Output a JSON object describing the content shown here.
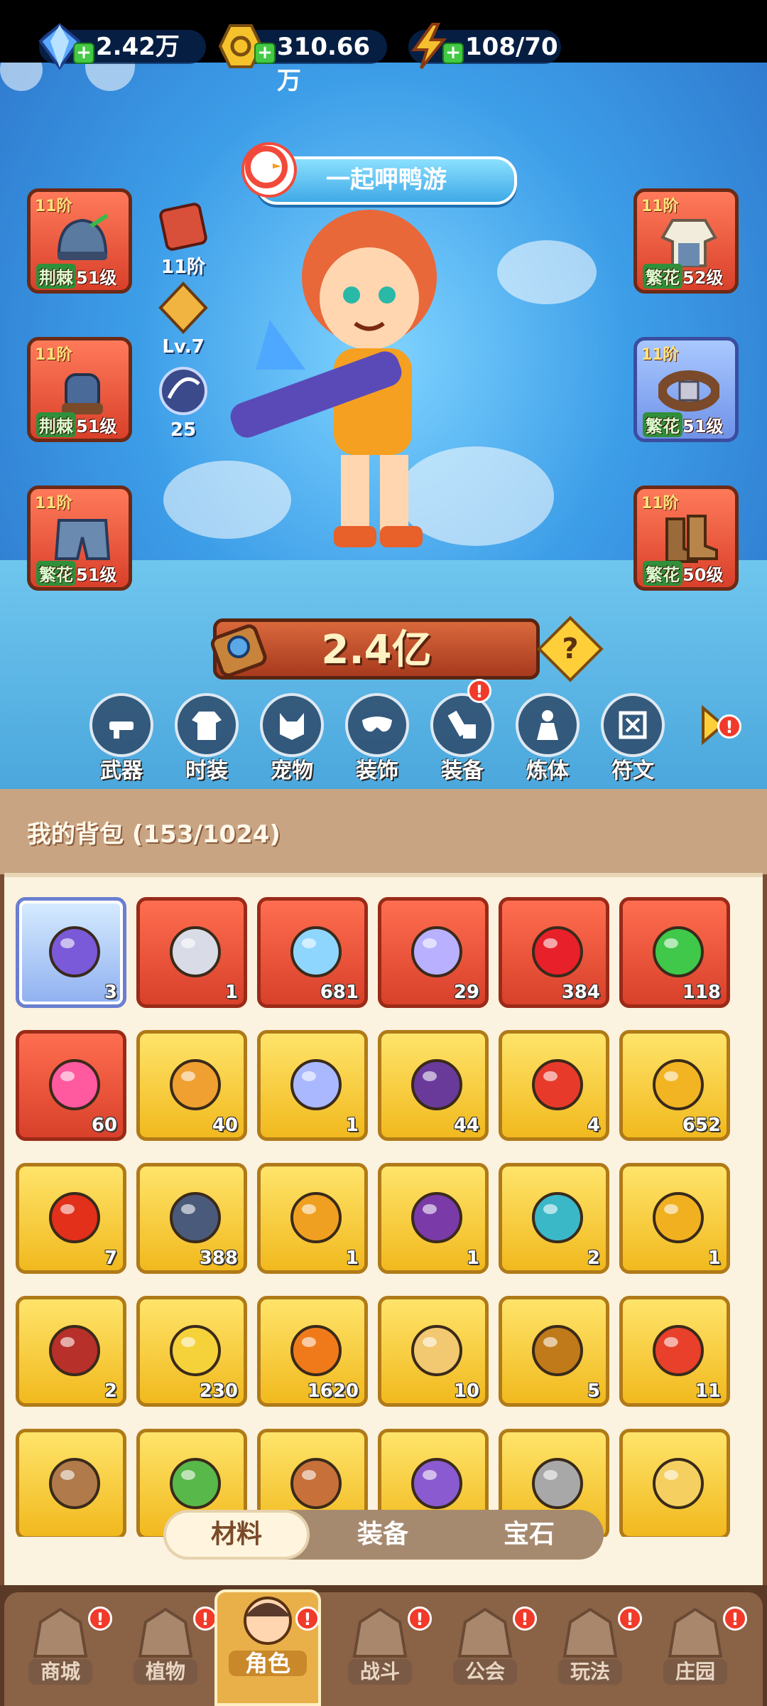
{
  "currencies": [
    {
      "name": "diamond",
      "value": "2.42万",
      "color": "#5aa8ff"
    },
    {
      "name": "gold",
      "value": "310.66万",
      "color": "#f6c22c"
    },
    {
      "name": "energy",
      "value": "108/70",
      "color": "#f5c030"
    }
  ],
  "event_banner": "一起呷鸭游",
  "equipment_left": [
    {
      "stage": "11阶",
      "tag": "荆棘",
      "level": "51级",
      "icon": "helmet-icon"
    },
    {
      "stage": "11阶",
      "tag": "荆棘",
      "level": "51级",
      "icon": "gloves-icon"
    },
    {
      "stage": "11阶",
      "tag": "繁花",
      "level": "51级",
      "icon": "shorts-icon"
    }
  ],
  "equipment_right": [
    {
      "stage": "11阶",
      "tag": "繁花",
      "level": "52级",
      "icon": "jacket-icon"
    },
    {
      "stage": "11阶",
      "tag": "繁花",
      "level": "51级",
      "icon": "belt-icon"
    },
    {
      "stage": "11阶",
      "tag": "繁花",
      "level": "50级",
      "icon": "boots-icon"
    }
  ],
  "mini_stats": [
    {
      "label": "11阶",
      "icon": "backpack-icon"
    },
    {
      "label": "Lv.7",
      "icon": "crystal-icon"
    },
    {
      "label": "25",
      "icon": "orb-icon"
    }
  ],
  "power": "2.4亿",
  "help_label": "?",
  "features": [
    {
      "label": "武器",
      "icon": "weapon-icon",
      "alert": false
    },
    {
      "label": "时装",
      "icon": "outfit-icon",
      "alert": false
    },
    {
      "label": "宠物",
      "icon": "pet-icon",
      "alert": false
    },
    {
      "label": "装饰",
      "icon": "mask-icon",
      "alert": false
    },
    {
      "label": "装备",
      "icon": "equipment-icon",
      "alert": true
    },
    {
      "label": "炼体",
      "icon": "body-icon",
      "alert": false
    },
    {
      "label": "符文",
      "icon": "rune-icon",
      "alert": false
    }
  ],
  "alert_mark": "!",
  "bag": {
    "title": "我的背包 (153/1024)",
    "items": [
      {
        "count": "3",
        "bg": "blue",
        "icon": "mask-icon",
        "color": "#7a5ad8"
      },
      {
        "count": "1",
        "bg": "red",
        "icon": "gear-cross-icon",
        "color": "#d9dce6"
      },
      {
        "count": "681",
        "bg": "red",
        "icon": "star-crystal-icon",
        "color": "#8fd6ff"
      },
      {
        "count": "29",
        "bg": "red",
        "icon": "moon-crystal-icon",
        "color": "#b9b0ff"
      },
      {
        "count": "384",
        "bg": "red",
        "icon": "red-potion-icon",
        "color": "#e8202a"
      },
      {
        "count": "118",
        "bg": "red",
        "icon": "green-tube-icon",
        "color": "#3fc84a"
      },
      {
        "count": "60",
        "bg": "red",
        "icon": "fire-fruit-icon",
        "color": "#ff5aa0"
      },
      {
        "count": "40",
        "bg": "gold",
        "icon": "elixir-bottle-icon",
        "color": "#f0a030"
      },
      {
        "count": "1",
        "bg": "gold",
        "icon": "water-drop-icon",
        "color": "#a9b8ff"
      },
      {
        "count": "44",
        "bg": "gold",
        "icon": "skull-book-icon",
        "color": "#6a3a9a"
      },
      {
        "count": "4",
        "bg": "gold",
        "icon": "red-key-icon",
        "color": "#e83a2a"
      },
      {
        "count": "652",
        "bg": "gold",
        "icon": "gold-key-icon",
        "color": "#f2b422"
      },
      {
        "count": "7",
        "bg": "gold",
        "icon": "flame-icon",
        "color": "#e2301a"
      },
      {
        "count": "388",
        "bg": "gold",
        "icon": "triangle-shard-icon",
        "color": "#4a5a7a"
      },
      {
        "count": "1",
        "bg": "gold",
        "icon": "amber-gem-icon",
        "color": "#f0a020"
      },
      {
        "count": "1",
        "bg": "gold",
        "icon": "purple-orb-icon",
        "color": "#7a3aa8"
      },
      {
        "count": "2",
        "bg": "gold",
        "icon": "mushroom-icon",
        "color": "#3ab8c8"
      },
      {
        "count": "1",
        "bg": "gold",
        "icon": "gold-planet-icon",
        "color": "#f0b020"
      },
      {
        "count": "2",
        "bg": "gold",
        "icon": "red-book-icon",
        "color": "#b8302a"
      },
      {
        "count": "230",
        "bg": "gold",
        "icon": "lemon-icon",
        "color": "#f5d23a"
      },
      {
        "count": "1620",
        "bg": "gold",
        "icon": "orange-potion-icon",
        "color": "#f07a1a"
      },
      {
        "count": "10",
        "bg": "gold",
        "icon": "crystal-cluster-icon",
        "color": "#f2c870"
      },
      {
        "count": "5",
        "bg": "gold",
        "icon": "ore-icon",
        "color": "#c07a1a"
      },
      {
        "count": "11",
        "bg": "gold",
        "icon": "red-flower-icon",
        "color": "#e8402a"
      },
      {
        "count": "",
        "bg": "gold",
        "icon": "pot-icon",
        "color": "#b07a4a"
      },
      {
        "count": "",
        "bg": "gold",
        "icon": "green-crate-icon",
        "color": "#58b84a"
      },
      {
        "count": "",
        "bg": "gold",
        "icon": "clay-jar-icon",
        "color": "#c8703a"
      },
      {
        "count": "",
        "bg": "gold",
        "icon": "purple-tome-icon",
        "color": "#8a5ad0"
      },
      {
        "count": "",
        "bg": "gold",
        "icon": "stone-bowl-icon",
        "color": "#a8a8a8"
      },
      {
        "count": "",
        "bg": "gold",
        "icon": "chick-icon",
        "color": "#f5d060"
      }
    ]
  },
  "tabs": [
    {
      "label": "材料",
      "active": true
    },
    {
      "label": "装备",
      "active": false
    },
    {
      "label": "宝石",
      "active": false
    }
  ],
  "bottom_nav": [
    {
      "label": "商城",
      "icon": "shop-icon",
      "alert": true,
      "active": false
    },
    {
      "label": "植物",
      "icon": "plant-icon",
      "alert": true,
      "active": false
    },
    {
      "label": "角色",
      "icon": "hero-avatar-icon",
      "alert": true,
      "active": true
    },
    {
      "label": "战斗",
      "icon": "battle-icon",
      "alert": true,
      "active": false
    },
    {
      "label": "公会",
      "icon": "guild-icon",
      "alert": true,
      "active": false
    },
    {
      "label": "玩法",
      "icon": "gameplay-icon",
      "alert": true,
      "active": false
    },
    {
      "label": "庄园",
      "icon": "manor-icon",
      "alert": true,
      "active": false
    }
  ]
}
